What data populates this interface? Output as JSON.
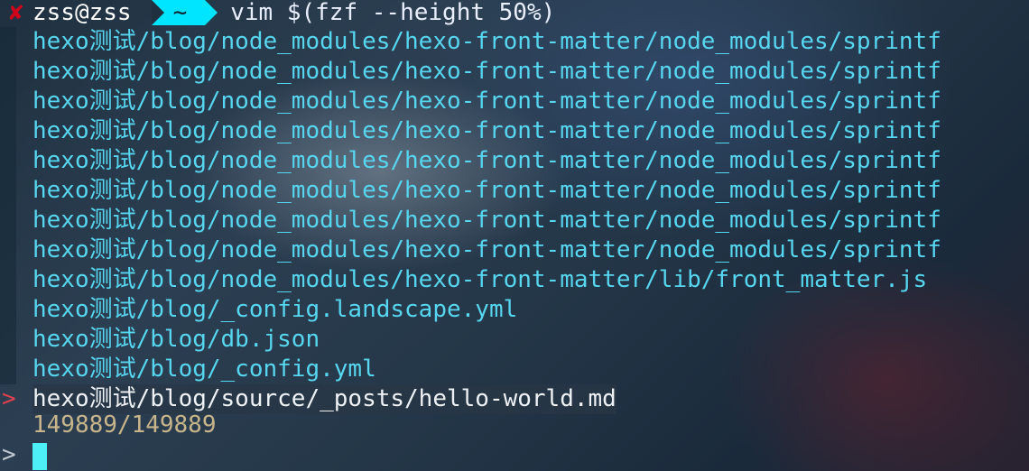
{
  "prompt": {
    "status_icon": "x-mark",
    "user_host": "zss@zss",
    "directory": "~",
    "command": "vim $(fzf --height 50%)"
  },
  "results": [
    "hexo测试/blog/node_modules/hexo-front-matter/node_modules/sprintf",
    "hexo测试/blog/node_modules/hexo-front-matter/node_modules/sprintf",
    "hexo测试/blog/node_modules/hexo-front-matter/node_modules/sprintf",
    "hexo测试/blog/node_modules/hexo-front-matter/node_modules/sprintf",
    "hexo测试/blog/node_modules/hexo-front-matter/node_modules/sprintf",
    "hexo测试/blog/node_modules/hexo-front-matter/node_modules/sprintf",
    "hexo测试/blog/node_modules/hexo-front-matter/node_modules/sprintf",
    "hexo测试/blog/node_modules/hexo-front-matter/node_modules/sprintf",
    "hexo测试/blog/node_modules/hexo-front-matter/lib/front_matter.js",
    "hexo测试/blog/_config.landscape.yml",
    "hexo测试/blog/db.json",
    "hexo测试/blog/_config.yml",
    "hexo测试/blog/source/_posts/hello-world.md"
  ],
  "selected_index": 12,
  "pointer": ">",
  "match_count": "149889/149889",
  "query_prompt": ">",
  "query": ""
}
